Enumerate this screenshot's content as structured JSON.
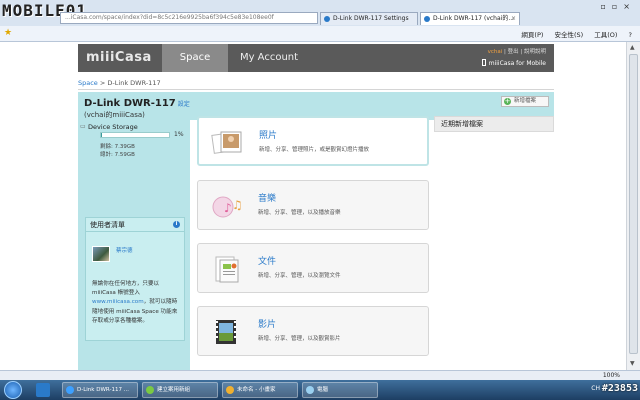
{
  "watermark": "MOBILE01",
  "watermark_id": "#23853",
  "browser": {
    "address": "...iCasa.com/space/index?did=8c5c216e9925ba6f394c5e83e108ee0f",
    "tabs": [
      {
        "label": "D-Link DWR-117 Settings"
      },
      {
        "label": "D-Link DWR-117 (vchai的..."
      }
    ],
    "menu": [
      "網頁(P)",
      "安全性(S)",
      "工具(O)",
      "?"
    ],
    "zoom": "100%"
  },
  "header": {
    "logo": "miiiCasa",
    "nav_space": "Space",
    "nav_account": "My Account",
    "links": {
      "user": "vchai",
      "sep1": "|",
      "logout": "登出",
      "sep2": "|",
      "help": "說明說明"
    },
    "mobile": "miiiCasa for Mobile"
  },
  "breadcrumb": {
    "root": "Space",
    "sep": ">",
    "current": "D-Link DWR-117"
  },
  "device": {
    "name": "D-Link DWR-117",
    "settings": "設定",
    "owner": "(vchai的miiiCasa)",
    "add_button": "新增檔案"
  },
  "storage": {
    "label": "Device Storage",
    "percent": "1%",
    "percent_value": 1,
    "used": "剩餘: 7.39GB",
    "total": "總計: 7.59GB"
  },
  "users": {
    "title": "使用者清單",
    "info": "i",
    "user_name": "蔡宗德",
    "desc_1": "無論你在任何地方，只要以miiiCasa 帳號登入",
    "desc_link": "www.miiicasa.com",
    "desc_2": "，就可以隨時隨地使用 miiiCasa Space 功能來存取或分享各種檔案。"
  },
  "cards": [
    {
      "title": "照片",
      "desc": "新增、分享、管理照片，或是觀賞幻燈片播放"
    },
    {
      "title": "音樂",
      "desc": "新增、分享、管理，以及播放音樂"
    },
    {
      "title": "文件",
      "desc": "新增、分享、管理，以及瀏覽文件"
    },
    {
      "title": "影片",
      "desc": "新增、分享、管理，以及觀賞影片"
    }
  ],
  "recent_title": "近期新增檔案",
  "taskbar": {
    "items": [
      "D-Link DWR-117 ...",
      "建立案用新組",
      "未命名 - 小畫家",
      "電腦"
    ],
    "lang": "CH"
  },
  "colors": {
    "accent": "#b8e4e8",
    "link": "#2a7ac9",
    "header": "#5a5a5a"
  }
}
